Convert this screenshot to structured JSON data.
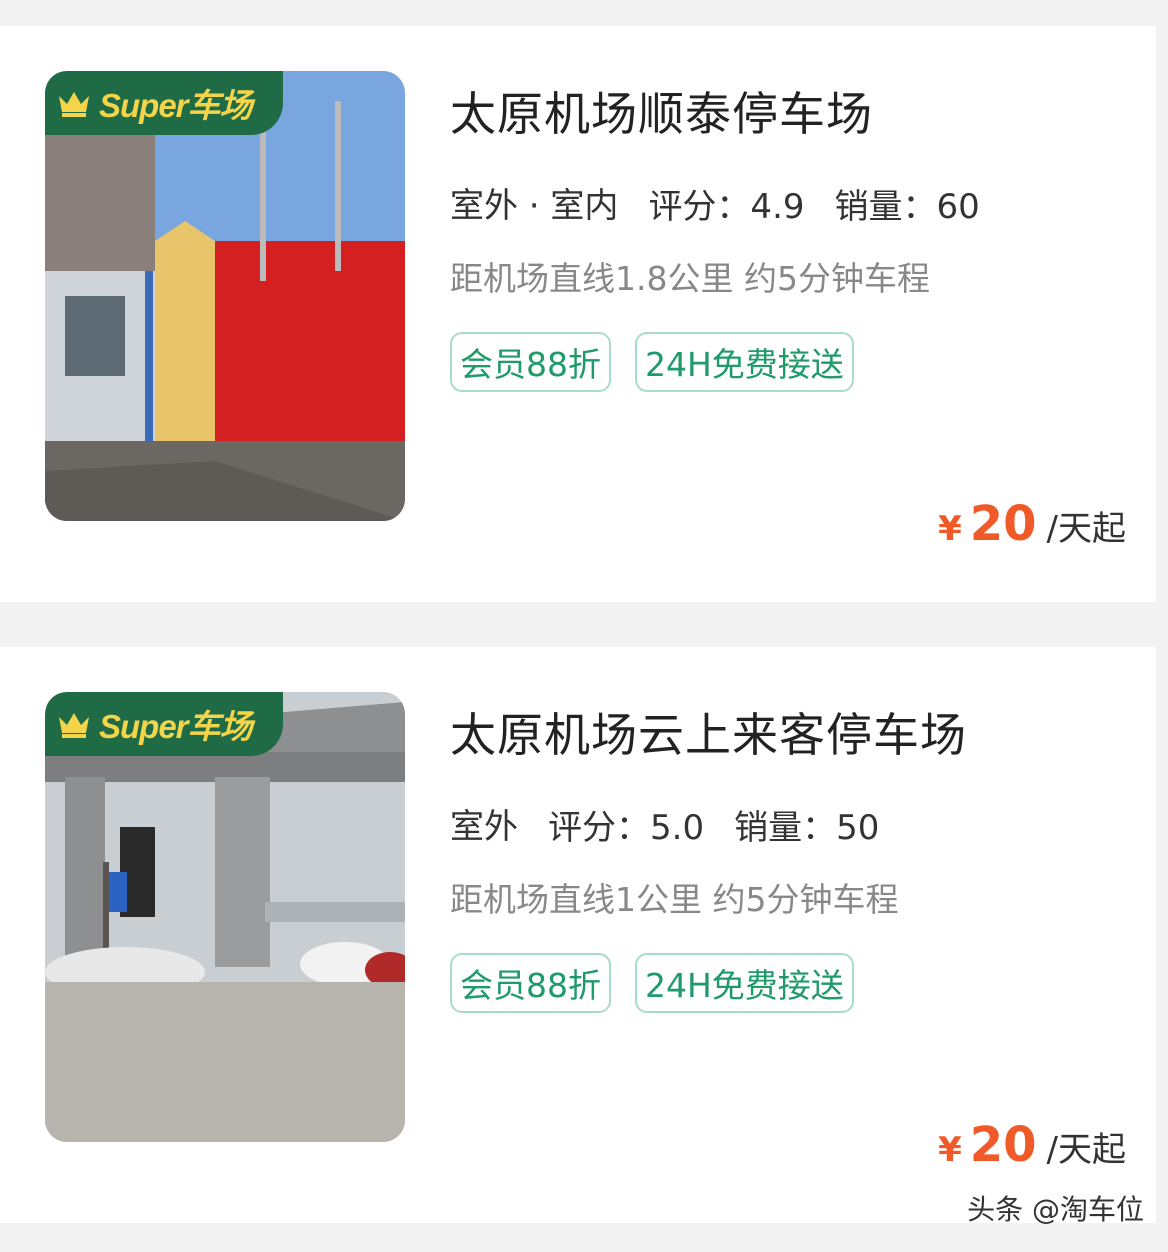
{
  "listings": [
    {
      "badge": "Super车场",
      "name": "太原机场顺泰停车场",
      "type": "室外 · 室内",
      "rating_label": "评分：4.9",
      "sales_label": "销量：60",
      "distance": "距机场直线1.8公里 约5分钟车程",
      "tags": [
        "会员88折",
        "24H免费接送"
      ],
      "currency": "¥",
      "price": "20",
      "price_unit": "/天起"
    },
    {
      "badge": "Super车场",
      "name": "太原机场云上来客停车场",
      "type": "室外",
      "rating_label": "评分：5.0",
      "sales_label": "销量：50",
      "distance": "距机场直线1公里 约5分钟车程",
      "tags": [
        "会员88折",
        "24H免费接送"
      ],
      "currency": "¥",
      "price": "20",
      "price_unit": "/天起"
    }
  ],
  "watermark": "头条 @淘车位",
  "colors": {
    "badge_bg": "#1f6b45",
    "badge_text": "#f4d54a",
    "tag_text": "#1f9a6a",
    "price": "#f05a28"
  },
  "icons": [
    "crown-icon"
  ]
}
